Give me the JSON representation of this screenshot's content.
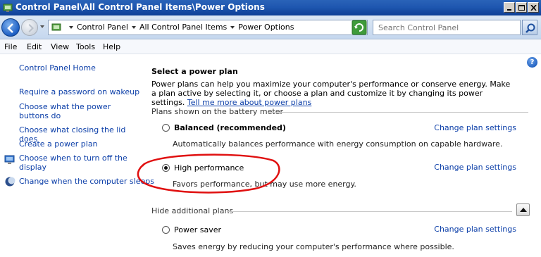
{
  "window": {
    "title": "Control Panel\\All Control Panel Items\\Power Options"
  },
  "address_bar": {
    "crumbs": [
      "Control Panel",
      "All Control Panel Items",
      "Power Options"
    ]
  },
  "search": {
    "placeholder": "Search Control Panel"
  },
  "menu": {
    "items": [
      "File",
      "Edit",
      "View",
      "Tools",
      "Help"
    ]
  },
  "sidebar": {
    "home": "Control Panel Home",
    "links": [
      {
        "label": "Require a password on wakeup",
        "icon": "none"
      },
      {
        "label": "Choose what the power buttons do",
        "icon": "none"
      },
      {
        "label": "Choose what closing the lid does",
        "icon": "none"
      },
      {
        "label": "Create a power plan",
        "icon": "none"
      },
      {
        "label": "Choose when to turn off the display",
        "icon": "monitor-icon"
      },
      {
        "label": "Change when the computer sleeps",
        "icon": "moon-icon"
      }
    ]
  },
  "main": {
    "heading": "Select a power plan",
    "description": "Power plans can help you maximize your computer's performance or conserve energy. Make a plan active by selecting it, or choose a plan and customize it by changing its power settings.",
    "description_link": "Tell me more about power plans",
    "battery_section": "Plans shown on the battery meter",
    "hide_section": "Hide additional plans",
    "plans": [
      {
        "name": "Balanced (recommended)",
        "description": "Automatically balances performance with energy consumption on capable hardware.",
        "selected": false,
        "action": "Change plan settings"
      },
      {
        "name": "High performance",
        "description": "Favors performance, but may use more energy.",
        "selected": true,
        "action": "Change plan settings"
      },
      {
        "name": "Power saver",
        "description": "Saves energy by reducing your computer's performance where possible.",
        "selected": false,
        "action": "Change plan settings"
      }
    ]
  },
  "colors": {
    "link": "#0b3ea8",
    "title_bar": "#1f57b0",
    "annotation": "#e01010"
  }
}
